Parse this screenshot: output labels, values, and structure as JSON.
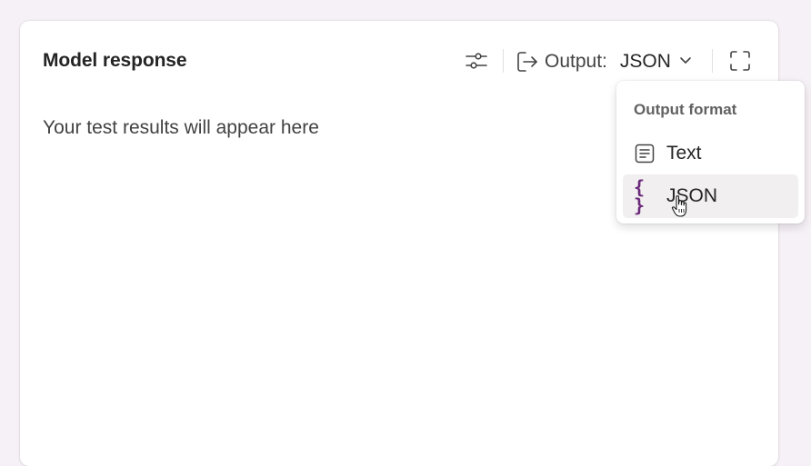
{
  "panel": {
    "title": "Model response",
    "placeholder": "Your test results will appear here"
  },
  "toolbar": {
    "settings_icon": "sliders-icon",
    "output_icon": "export-icon",
    "output_label": "Output:",
    "output_value": "JSON",
    "dropdown_icon": "chevron-down-icon",
    "fullscreen_icon": "fullscreen-icon"
  },
  "output_menu": {
    "header": "Output format",
    "items": [
      {
        "label": "Text",
        "icon": "text-document-icon",
        "selected": false
      },
      {
        "label": "JSON",
        "icon": "braces-icon",
        "glyph": "{ }",
        "selected": true,
        "hovered": true
      }
    ]
  },
  "colors": {
    "page_background": "#f6f1f7",
    "card_background": "#ffffff",
    "json_icon": "#6b2a7a",
    "hover_background": "#f1efef"
  }
}
